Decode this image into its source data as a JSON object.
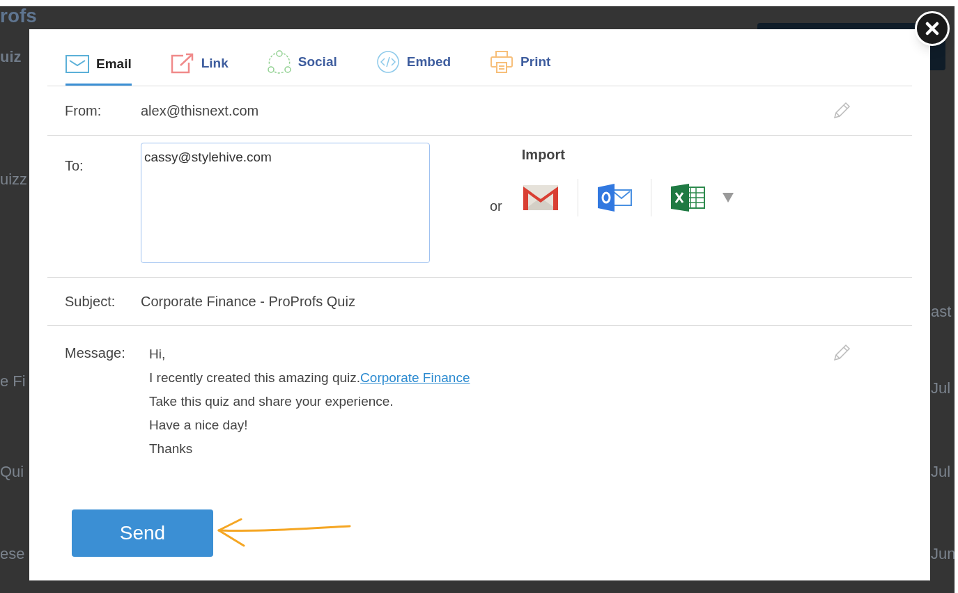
{
  "background": {
    "logo": "rofs",
    "logo_sub": "uiz",
    "fragments": [
      {
        "kind": "left",
        "text": "uizz"
      },
      {
        "kind": "right",
        "text": "ast"
      },
      {
        "kind": "left",
        "text": "e Fi"
      },
      {
        "kind": "right",
        "text": "Jul"
      },
      {
        "kind": "left",
        "text": "Qui"
      },
      {
        "kind": "right",
        "text": "Jul"
      },
      {
        "kind": "left",
        "text": "ese"
      },
      {
        "kind": "right",
        "text": "Jun"
      }
    ]
  },
  "tabs": [
    {
      "label": "Email",
      "kind": "email",
      "selected": true
    },
    {
      "label": "Link",
      "kind": "link",
      "selected": false
    },
    {
      "label": "Social",
      "kind": "social",
      "selected": false
    },
    {
      "label": "Embed",
      "kind": "embed",
      "selected": false
    },
    {
      "label": "Print",
      "kind": "print",
      "selected": false
    }
  ],
  "from": {
    "label": "From:",
    "value": "alex@thisnext.com"
  },
  "to": {
    "label": "To:",
    "value": "cassy@stylehive.com"
  },
  "import": {
    "title": "Import",
    "or": "or",
    "providers": [
      {
        "kind": "gmail"
      },
      {
        "kind": "outlook"
      },
      {
        "kind": "excel"
      }
    ]
  },
  "subject": {
    "label": "Subject:",
    "value": "Corporate Finance - ProProfs Quiz"
  },
  "message": {
    "label": "Message:",
    "lines": [
      {
        "text": "Hi,"
      },
      {
        "text": "I recently created this amazing quiz.",
        "link": "Corporate Finance"
      },
      {
        "text": "Take this quiz and share your experience."
      },
      {
        "text": "Have a nice day!"
      },
      {
        "text": "Thanks"
      }
    ]
  },
  "send_button": "Send"
}
